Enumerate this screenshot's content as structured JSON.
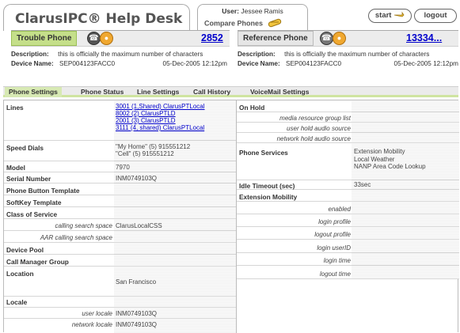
{
  "app": {
    "brand": "ClarusIPC® Help Desk",
    "user_label": "User:",
    "user_name": "Jessee Ramis",
    "compare_label": "Compare Phones",
    "start_label": "start",
    "logout_label": "logout"
  },
  "device_left": {
    "name": "Trouble Phone",
    "number": "2852",
    "description_label": "Description:",
    "description_value": "this is officially the maximum number of characters",
    "device_name_label": "Device Name:",
    "device_name_value": "SEP004123FACC0",
    "timestamp": "05-Dec-2005 12:12pm"
  },
  "device_right": {
    "name": "Reference Phone",
    "number": "13334...",
    "description_label": "Description:",
    "description_value": "this is officially the maximum number of characters",
    "device_name_label": "Device Name:",
    "device_name_value": "SEP004123FACC0",
    "timestamp": "05-Dec-2005 12:12pm"
  },
  "tabs": [
    {
      "label": "Phone Settings",
      "active": true
    },
    {
      "label": "Phone Status"
    },
    {
      "label": "Line Settings"
    },
    {
      "label": "Call History"
    },
    {
      "label": "VoiceMail Settings"
    }
  ],
  "left_panel": {
    "lines_label": "Lines",
    "lines": [
      "3001 (1,Shared) ClarusPTLocal",
      "8002 (2) ClarusPTLD",
      "2001 (3) ClarusPTLD",
      "3111 (4, shared) ClarusPTLocal"
    ],
    "speed_dials_label": "Speed Dials",
    "speed_dials": [
      "\"My Home\" (5) 915551212",
      "\"Cell\" (5) 915551212"
    ],
    "model_label": "Model",
    "model_value": "7970",
    "serial_label": "Serial Number",
    "serial_value": "INM0749103Q",
    "button_template_label": "Phone Button Template",
    "softkey_template_label": "SoftKey Template",
    "cos_label": "Class of Service",
    "css_label": "calling search space",
    "css_value": "ClarusLocalCSS",
    "aar_css_label": "AAR calling search space",
    "device_pool_label": "Device Pool",
    "cm_group_label": "Call Manager Group",
    "location_label": "Location",
    "location_value": "San Francisco",
    "locale_label": "Locale",
    "user_locale_label": "user locale",
    "user_locale_value": "INM0749103Q",
    "network_locale_label": "network locale",
    "network_locale_value": "INM0749103Q"
  },
  "right_panel": {
    "on_hold_label": "On Hold",
    "mrgl_label": "media resource group list",
    "user_hold_label": "user hold audio source",
    "network_hold_label": "network hold audio source",
    "services_label": "Phone Services",
    "services": [
      "Extension Mobility",
      "Local Weather",
      "NANP Area Code Lookup"
    ],
    "idle_label": "Idle Timeout (sec)",
    "idle_value": "33sec",
    "em_label": "Extension Mobility",
    "em_enabled_label": "enabled",
    "em_login_profile_label": "login profile",
    "em_logout_profile_label": "logout profile",
    "em_login_userid_label": "login userID",
    "em_login_time_label": "login time",
    "em_logout_time_label": "logout time"
  }
}
